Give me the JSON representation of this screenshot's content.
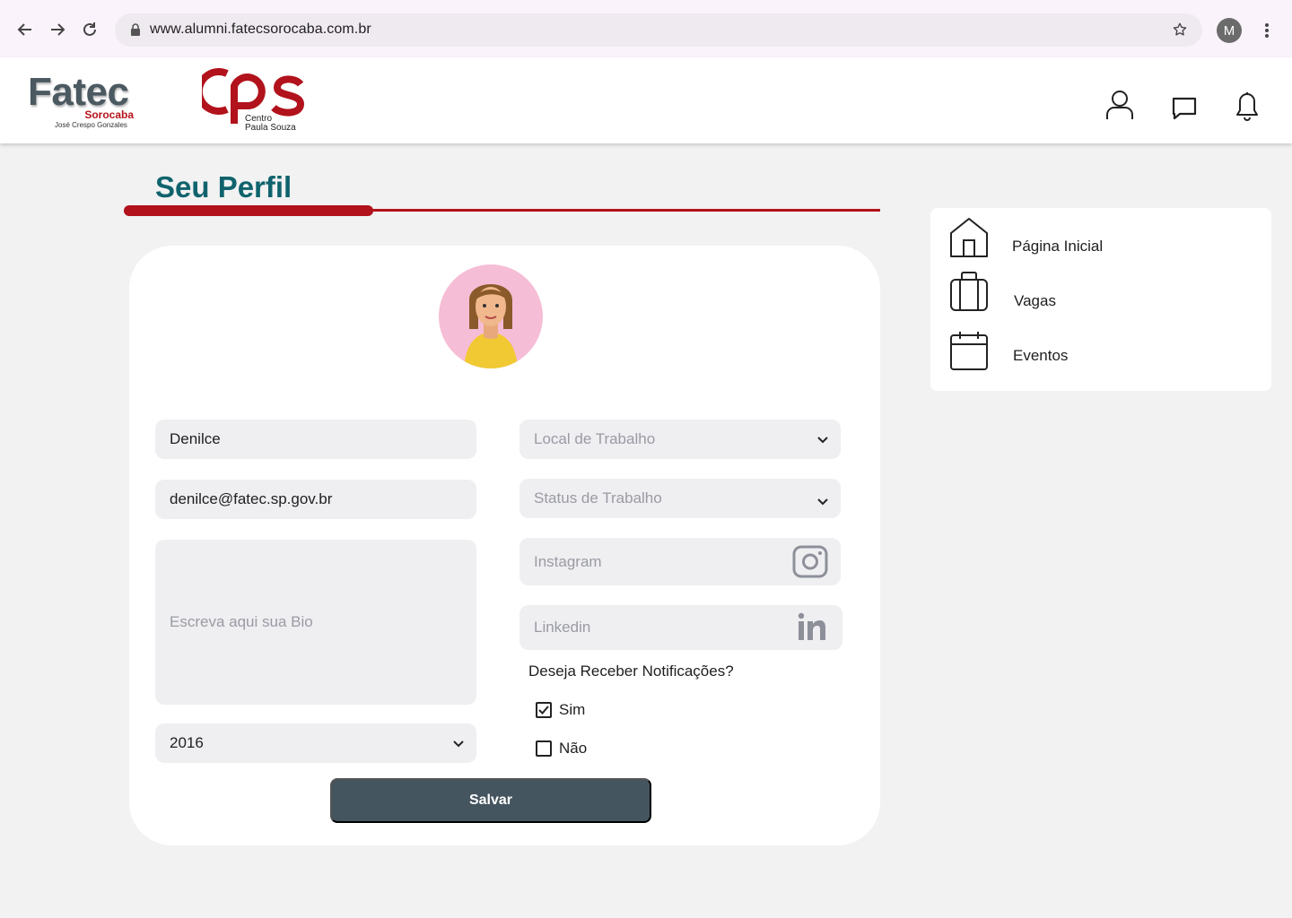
{
  "browser": {
    "url": "www.alumni.fatecsorocaba.com.br",
    "profile_initial": "M"
  },
  "header": {
    "fatec_logo": {
      "name": "Fatec",
      "city": "Sorocaba",
      "subtitle": "José Crespo Gonzales"
    },
    "cps_logo": {
      "line1": "Centro",
      "line2": "Paula Souza"
    }
  },
  "page": {
    "title": "Seu Perfil"
  },
  "form": {
    "name_value": "Denilce",
    "email_value": "denilce@fatec.sp.gov.br",
    "bio_placeholder": "Escreva aqui sua Bio",
    "year_value": "2016",
    "workplace_placeholder": "Local de Trabalho",
    "work_status_placeholder": "Status de Trabalho",
    "instagram_placeholder": "Instagram",
    "linkedin_placeholder": "Linkedin",
    "notifications_question": "Deseja Receber Notificações?",
    "option_yes": "Sim",
    "option_no": "Não",
    "yes_checked": true,
    "no_checked": false,
    "save_label": "Salvar"
  },
  "sidebar": {
    "items": [
      {
        "label": "Página Inicial",
        "icon": "home-icon"
      },
      {
        "label": "Vagas",
        "icon": "briefcase-icon"
      },
      {
        "label": "Eventos",
        "icon": "calendar-icon"
      }
    ]
  },
  "colors": {
    "title": "#10636d",
    "accent_red": "#b1121b",
    "button": "#45555f",
    "field_bg": "#efeff2",
    "page_bg": "#f2f2f2"
  }
}
